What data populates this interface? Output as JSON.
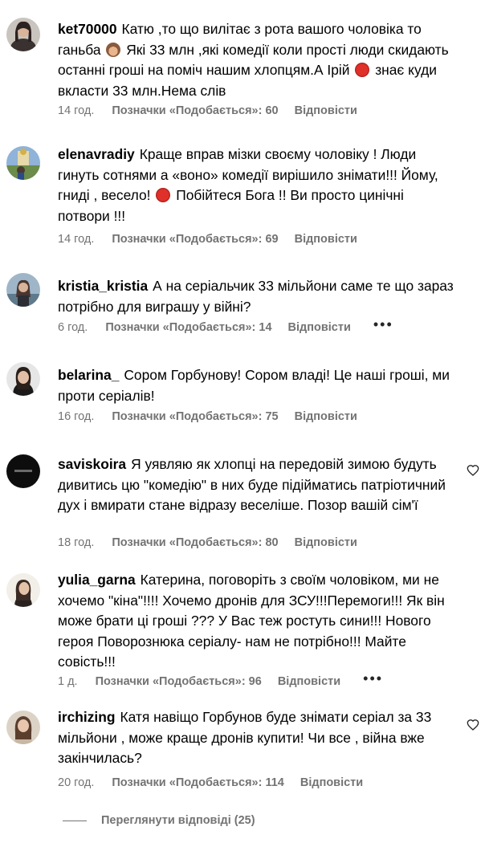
{
  "comments": [
    {
      "username": "ket70000",
      "text_1": "Катю ,то що вилітає з рота вашого чоловіка то ганьба",
      "emoji_1": "see-no-evil-monkey",
      "text_2": "Які 33 млн ,які комедії коли прості люди скидають останні гроші на поміч нашим хлопцям.А Ірій",
      "emoji_2": "angry-face",
      "text_3": "знає куди вкласти 33 млн.Нема слів",
      "time": "14 год.",
      "likes": "Позначки «Подобається»: 60",
      "reply": "Відповісти"
    },
    {
      "username": "elenavradiy",
      "text_1": "Краще вправ мізки своєму чоловіку ! Люди гинуть сотнями а «воно» комедії вирішило знімати!!! Йому, гниді , весело!",
      "emoji_1": "angry-face",
      "text_2": "Побійтеся Бога !! Ви просто цинічні потвори !!!",
      "time": "14 год.",
      "likes": "Позначки «Подобається»: 69",
      "reply": "Відповісти"
    },
    {
      "username": "kristia_kristia",
      "text": "А на серіальчик 33 мільйони саме те що зараз потрібно для виграшу у війні?",
      "time": "6 год.",
      "likes": "Позначки «Подобається»: 14",
      "reply": "Відповісти",
      "more": "•••"
    },
    {
      "username": "belarina_",
      "text": "Сором Горбунову! Сором владі! Це наші гроші, ми проти серіалів!",
      "time": "16 год.",
      "likes": "Позначки «Подобається»: 75",
      "reply": "Відповісти"
    },
    {
      "username": "saviskoira",
      "text": "Я уявляю як хлопці на передовій зимою будуть дивитись цю \"комедію\" в них буде підійматись патріотичний дух і вмирати стане відразу веселіше. Позор вашій сім'ї",
      "time": "18 год.",
      "likes": "Позначки «Подобається»: 80",
      "reply": "Відповісти"
    },
    {
      "username": "yulia_garna",
      "text": "Катерина, поговоріть з своїм чоловіком, ми не хочемо \"кіна\"!!!! Хочемо дронів для ЗСУ!!!Перемоги!!! Як він може брати ці гроші ??? У Вас теж ростуть сини!!! Нового героя Поворознюка серіалу- нам не потрібно!!! Майте совість!!!",
      "time": "1 д.",
      "likes": "Позначки «Подобається»: 96",
      "reply": "Відповісти",
      "more": "•••"
    },
    {
      "username": "irchizing",
      "text": "Катя навіщо Горбунов буде знімати серіал за 33 мільйони , може краще дронів купити! Чи все , війна вже закінчилась?",
      "time": "20 год.",
      "likes": "Позначки «Подобається»: 114",
      "reply": "Відповісти"
    }
  ],
  "view_replies": "Переглянути відповіді (25)",
  "colors": {
    "text": "#000000",
    "meta": "#737373"
  }
}
